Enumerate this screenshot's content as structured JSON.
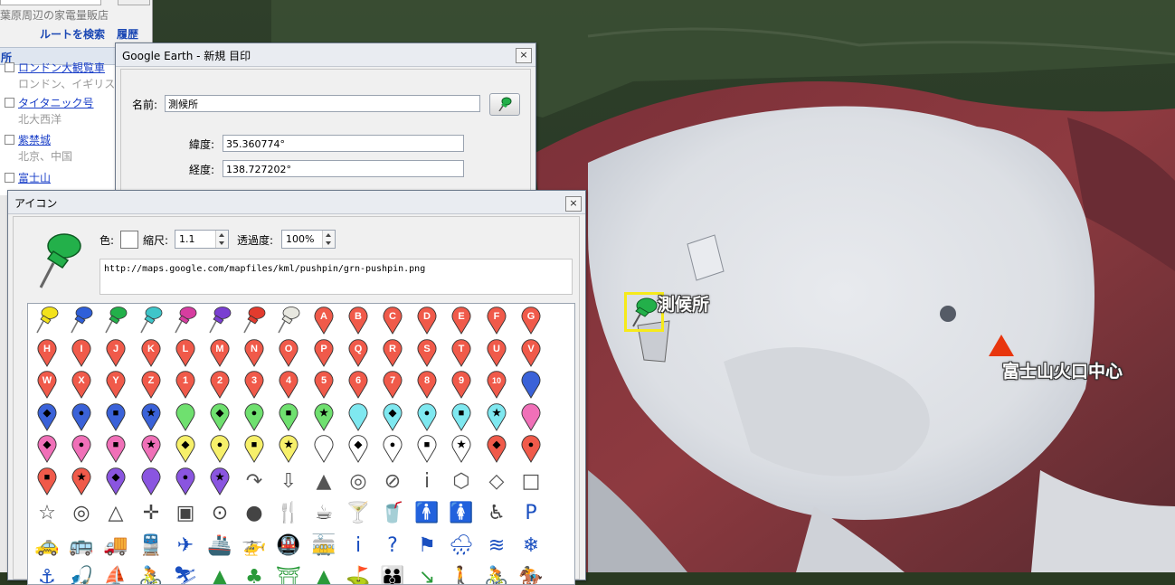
{
  "map": {
    "placemark_label": "測候所",
    "crater_label": "富士山火口中心"
  },
  "sidebar": {
    "shop_text": "葉原周辺の家電量販店",
    "route_link": "ルートを検索",
    "history_link": "履歴",
    "section_label": "所",
    "items": [
      {
        "title": "ロンドン大観覧車",
        "sub": "ロンドン、イギリス"
      },
      {
        "title": "タイタニック号",
        "sub": "北大西洋"
      },
      {
        "title": "紫禁城",
        "sub": "北京、中国"
      },
      {
        "title": "富士山",
        "sub": ""
      }
    ]
  },
  "placemark_dialog": {
    "title": "Google Earth - 新規 目印",
    "close": "×",
    "name_label": "名前:",
    "name_value": "測候所",
    "lat_label": "緯度:",
    "lat_value": "35.360774°",
    "lon_label": "経度:",
    "lon_value": "138.727202°"
  },
  "icon_dialog": {
    "title": "アイコン",
    "close": "×",
    "color_label": "色:",
    "scale_label": "縮尺:",
    "scale_value": "1.1",
    "opacity_label": "透過度:",
    "opacity_value": "100%",
    "url": "http://maps.google.com/mapfiles/kml/pushpin/grn-pushpin.png",
    "pushpin_colors": [
      "#f3e21c",
      "#2f5fd8",
      "#23b04a",
      "#3fc5c9",
      "#d63da0",
      "#7a3fd1",
      "#e23b2e",
      "#e8e8e0"
    ],
    "grid_rows": [
      [
        "pushpin-yellow",
        "pushpin-blue",
        "pushpin-green",
        "pushpin-ltblue",
        "pushpin-pink",
        "pushpin-purple",
        "pushpin-red",
        "pushpin-white",
        "A",
        "B",
        "C",
        "D",
        "E",
        "F",
        "G"
      ],
      [
        "H",
        "I",
        "J",
        "K",
        "L",
        "M",
        "N",
        "O",
        "P",
        "Q",
        "R",
        "S",
        "T",
        "U",
        "V"
      ],
      [
        "W",
        "X",
        "Y",
        "Z",
        "1",
        "2",
        "3",
        "4",
        "5",
        "6",
        "7",
        "8",
        "9",
        "10",
        "blank"
      ]
    ],
    "shape_rows": [
      [
        [
          "#3a62d8",
          "◆"
        ],
        [
          "#3a62d8",
          "●"
        ],
        [
          "#3a62d8",
          "■"
        ],
        [
          "#3a62d8",
          "★"
        ],
        [
          "#6fe06f",
          ""
        ],
        [
          "#6fe06f",
          "◆"
        ],
        [
          "#6fe06f",
          "●"
        ],
        [
          "#6fe06f",
          "■"
        ],
        [
          "#6fe06f",
          "★"
        ],
        [
          "#7fe8f0",
          ""
        ],
        [
          "#7fe8f0",
          "◆"
        ],
        [
          "#7fe8f0",
          "●"
        ],
        [
          "#7fe8f0",
          "■"
        ],
        [
          "#7fe8f0",
          "★"
        ],
        [
          "#f070b8",
          ""
        ]
      ],
      [
        [
          "#f070b8",
          "◆"
        ],
        [
          "#f070b8",
          "●"
        ],
        [
          "#f070b8",
          "■"
        ],
        [
          "#f070b8",
          "★"
        ],
        [
          "#f7f06a",
          "◆"
        ],
        [
          "#f7f06a",
          "●"
        ],
        [
          "#f7f06a",
          "■"
        ],
        [
          "#f7f06a",
          "★"
        ],
        [
          "#ffffff",
          ""
        ],
        [
          "#ffffff",
          "◆"
        ],
        [
          "#ffffff",
          "●"
        ],
        [
          "#ffffff",
          "■"
        ],
        [
          "#ffffff",
          "★"
        ],
        [
          "#f05a4a",
          "◆"
        ],
        [
          "#f05a4a",
          "●"
        ]
      ],
      [
        [
          "#f05a4a",
          "■"
        ],
        [
          "#f05a4a",
          "★"
        ],
        [
          "#8a55e0",
          "◆"
        ],
        [
          "#8a55e0",
          ""
        ],
        [
          "#8a55e0",
          "●"
        ],
        [
          "#8a55e0",
          "★"
        ]
      ]
    ],
    "misc_row": [
      "↷",
      "⇩",
      "▲",
      "◎",
      "⊘",
      "i",
      "⬡",
      "◇",
      "□"
    ],
    "misc_row2": [
      "☆",
      "◎",
      "△",
      "✛",
      "▣",
      "⊙",
      "●",
      "🍴",
      "☕",
      "🍸",
      "🥤",
      "🚹",
      "🚺",
      "♿",
      "P"
    ],
    "misc_row3": [
      "🚕",
      "🚌",
      "🚚",
      "🚆",
      "✈",
      "🚢",
      "🚁",
      "🚇",
      "🚋",
      "i",
      "?",
      "⚑",
      "🌧",
      "≋",
      "❄"
    ],
    "misc_row4": [
      "⚓",
      "🎣",
      "⛵",
      "🚴",
      "⛷",
      "▲",
      "♣",
      "⛩",
      "▲",
      "⛳",
      "👪",
      "↘",
      "🚶",
      "🚴",
      "🏇"
    ],
    "colors": {
      "marker_red": "#f05a4a",
      "blue_glyph": "#1a4fc0"
    }
  }
}
